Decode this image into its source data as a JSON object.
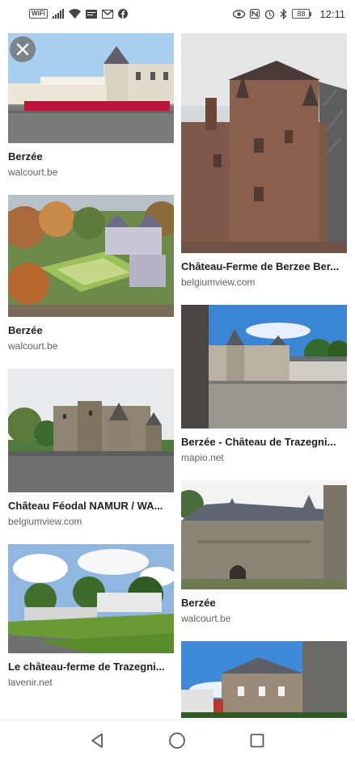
{
  "status_bar": {
    "left_icons": [
      "wifi-6-badge-icon",
      "signal-icon",
      "wifi-icon",
      "message-icon",
      "gmail-icon",
      "facebook-icon"
    ],
    "wifi_badge": "WiFi",
    "right_icons": [
      "eye-icon",
      "nfc-icon",
      "alarm-icon",
      "bluetooth-icon",
      "battery-icon"
    ],
    "battery": "88",
    "time": "12:11"
  },
  "results": {
    "left": [
      {
        "title": "Berzée",
        "source": "walcourt.be"
      },
      {
        "title": "Berzée",
        "source": "walcourt.be"
      },
      {
        "title": "Château Féodal NAMUR / WA...",
        "source": "belgiumview.com"
      },
      {
        "title": "Le château-ferme de Trazegni...",
        "source": "lavenir.net"
      }
    ],
    "right": [
      {
        "title": "Château-Ferme de Berzee Ber...",
        "source": "belgiumview.com"
      },
      {
        "title": "Berzée - Château de Trazegni...",
        "source": "mapio.net"
      },
      {
        "title": "Berzée",
        "source": "walcourt.be"
      }
    ]
  },
  "nav": {
    "back": "back-triangle-icon",
    "home": "home-circle-icon",
    "recents": "recents-square-icon"
  }
}
